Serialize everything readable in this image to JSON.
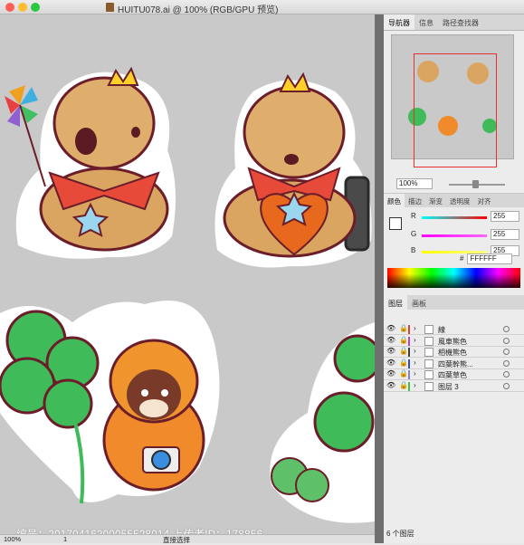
{
  "window": {
    "title": "HUITU078.ai @ 100% (RGB/GPU 预览)",
    "traffic_lights": {
      "close": "#ff5f57",
      "minimize": "#febc2e",
      "zoom": "#28c840"
    }
  },
  "navigator_panel": {
    "tabs": [
      "导航器",
      "信息",
      "路径查找器"
    ],
    "zoom_value": "100%"
  },
  "color_panel": {
    "tabs": [
      "颜色",
      "描边",
      "渐变",
      "透明度",
      "对齐"
    ],
    "channels": [
      {
        "label": "R",
        "value": "255"
      },
      {
        "label": "G",
        "value": "255"
      },
      {
        "label": "B",
        "value": "255"
      }
    ],
    "hex_value": "FFFFFF"
  },
  "layers_panel": {
    "tabs": [
      "图层",
      "画板"
    ],
    "layers": [
      {
        "name": "線",
        "color": "#d04040"
      },
      {
        "name": "風車熊色",
        "color": "#c040c0"
      },
      {
        "name": "相機熊色",
        "color": "#404040"
      },
      {
        "name": "四葉幹熊...",
        "color": "#3050c0"
      },
      {
        "name": "四葉草色",
        "color": "#8080e0"
      },
      {
        "name": "图层 3",
        "color": "#40c040"
      }
    ],
    "count": "6 个图层"
  },
  "status_bar": {
    "zoom": "100%",
    "artboard": "1",
    "tool": "直接选择"
  },
  "watermark": "编号：20170416200055528014 上传者ID：178856"
}
